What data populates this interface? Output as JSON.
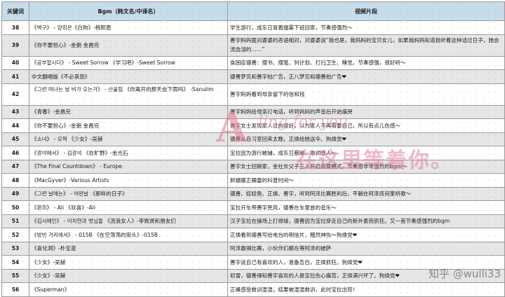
{
  "header": {
    "keyword": "关键词",
    "bgm": "Bgm（韩文名/中译名）",
    "clip": "视频片段"
  },
  "rows": [
    {
      "kw": "38",
      "bgm": "《벽구》 - 양희은《白狗》-杨熙恩",
      "clip": "学生游行，成东日冒着烟雾下班回家，节奏感强烈～"
    },
    {
      "kw": "39",
      "bgm": "《你不要担心》-金弼 金昌完",
      "clip": "善宇妈妈面对婆婆的恶语相对，对婆婆说“我也是，我妈妈的宝贝女儿，如果我妈妈知道我听着这种话过日子，她会流血泪的……”"
    },
    {
      "kw": "40",
      "bgm": "《공부합시다》 - Sweet Sorrow 《学习吧》-Sweet Sorrow",
      "clip": "食困症德善：摆书、摆笔、列计划、打扫卫生、睡觉。节奏感强，很好听～"
    },
    {
      "kw": "41",
      "bgm": "中文翻唱版《不必哀怨》",
      "clip": "德善梦见和善宇拍广告，正八梦见和德善拍广告❤"
    },
    {
      "kw": "42",
      "bgm": "《그런 떠나는 날 비가 오는가》 - 산울림 《你离开的那天会下雨吗》 -Sanulim",
      "clip": "善宇妈妈看到母亲留下的信和钱"
    },
    {
      "kw": "43",
      "bgm": "《青春》-金昌完",
      "clip": "善宇妈妈给母亲打电话，听到妈妈的声音后开始痛哭"
    },
    {
      "kw": "44",
      "bgm": "《你不要担心》-金弼 金昌完",
      "clip": "善宇女士发现家人过的很好，以为家人不再需要自己，所以有点儿伤感～"
    },
    {
      "kw": "45",
      "bgm": "《소녀》 - 오혁 《少女》-吴赫",
      "clip": "德善从自习室回来太晚，正焕给她送伞。狗焕党❤"
    },
    {
      "kw": "46",
      "bgm": "《광야에서》 - 김광석 《在旷野》-金光石",
      "clip": "宝拉因为游行被捕，成东日暴躁，歌词感人～"
    },
    {
      "kw": "47",
      "bgm": "《The Final Countdown》 - Europe",
      "clip": "善宇女士回娘家，金社长父子三人开启寂寞模式。节奏感非常强烈的bgm～"
    },
    {
      "kw": "48",
      "bgm": "《MacGyver》-Various Artists",
      "clip": "胖娜娜正确雷的科普时间～"
    },
    {
      "kw": "49",
      "bgm": "《그런 날에는》 - 어떤날 《那样的日子》",
      "clip": "德善、娃娃鱼、正焕、善宇，听到阿泽比赛胜利后，平躺在阿泽房间里听歌～"
    },
    {
      "kw": "50",
      "bgm": "《환희》 - Ali 《欢喜》-Ali",
      "clip": "宝拉开车带善宇兜风，德善在车里放的音乐～"
    },
    {
      "kw": "51",
      "bgm": "《김시에인》 - 이치현과 벗님들 《流浪女人》-李致贤和朋友们",
      "clip": "汉子宝拉在操场上打排球，德善因为宝拉穿走自己的新外套而抓狂。又一首节奏感强烈的bgm"
    },
    {
      "kw": "52",
      "bgm": "《방빈 거리에서》 - 015B 《在空荡荡的街头》-015B",
      "clip": "正焕看到德善写给电台的明信片，黯然神伤～狗焕党❤"
    },
    {
      "kw": "53",
      "bgm": "《喜化洞》-朴宝蓝",
      "clip": "阿泽赢得比赛，小伙伴们都在等阿泽的披萨"
    },
    {
      "kw": "54",
      "bgm": "《少女》-吴赫",
      "clip": "善宇说自己有喜欢的人，准备告白，正焕抓狂。狗焕党❤"
    },
    {
      "kw": "55",
      "bgm": "《少女》-吴赫",
      "clip": "初雪，德善得知善宇喜欢的人是宝拉伤心痛苦，正焕满兴坏了。狗焕党❤"
    },
    {
      "kw": "56",
      "bgm": "《Superman》",
      "clip": "正峰感受救训混混，结果被混混救训，此时宝拉出现！"
    }
  ],
  "watermark": {
    "letter": "A",
    "line": "ling for you",
    "cn": "在这里等着你。"
  },
  "credit": "知乎 @wulli33"
}
